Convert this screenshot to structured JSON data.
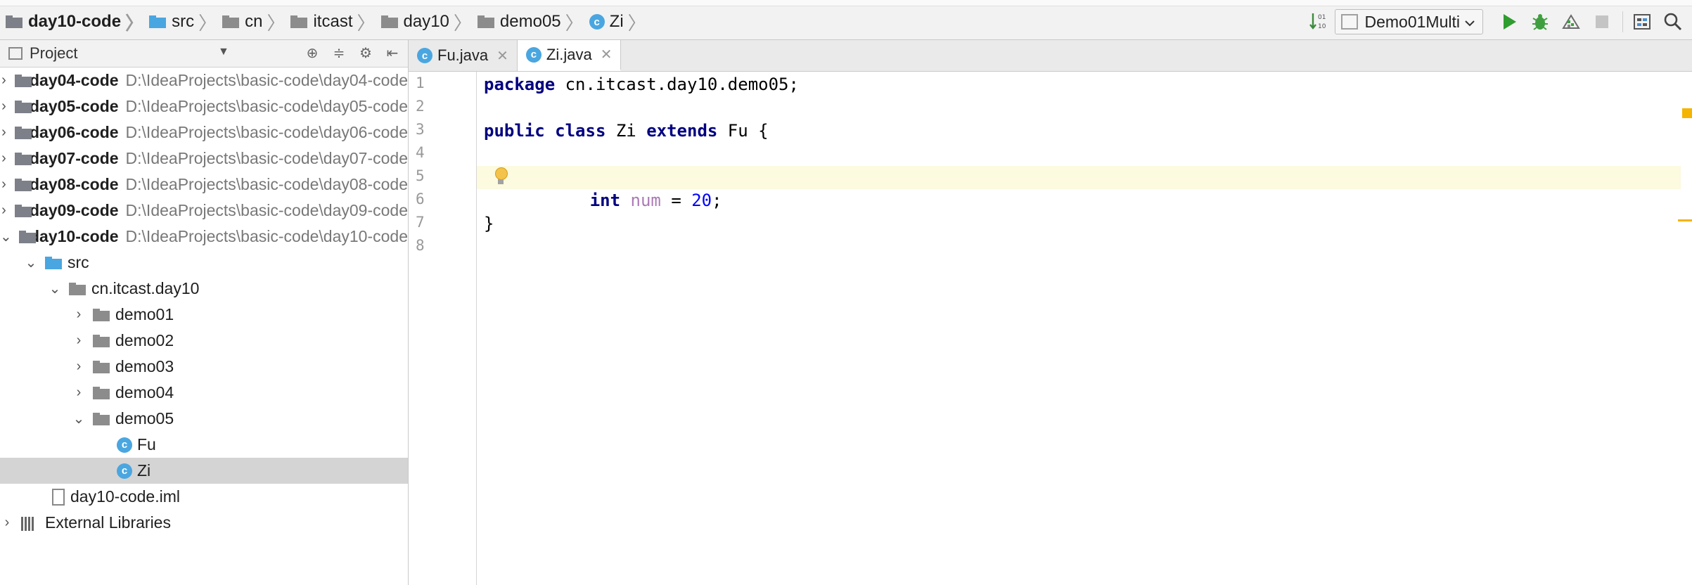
{
  "breadcrumb": {
    "items": [
      {
        "label": "day10-code",
        "icon": "module-folder-icon",
        "bold": true
      },
      {
        "label": "src",
        "icon": "source-folder-icon"
      },
      {
        "label": "cn",
        "icon": "package-folder-icon"
      },
      {
        "label": "itcast",
        "icon": "package-folder-icon"
      },
      {
        "label": "day10",
        "icon": "package-folder-icon"
      },
      {
        "label": "demo05",
        "icon": "package-folder-icon"
      },
      {
        "label": "Zi",
        "icon": "java-class-icon"
      }
    ]
  },
  "toolbar": {
    "run_config_label": "Demo01Multi",
    "icons": [
      "sort-icon",
      "run-icon",
      "debug-icon",
      "coverage-icon",
      "stop-icon",
      "project-structure-icon",
      "search-icon"
    ]
  },
  "project_pane": {
    "title": "Project",
    "tree": [
      {
        "name": "day04-code",
        "path": "D:\\IdeaProjects\\basic-code\\day04-code",
        "expanded": false
      },
      {
        "name": "day05-code",
        "path": "D:\\IdeaProjects\\basic-code\\day05-code",
        "expanded": false
      },
      {
        "name": "day06-code",
        "path": "D:\\IdeaProjects\\basic-code\\day06-code",
        "expanded": false
      },
      {
        "name": "day07-code",
        "path": "D:\\IdeaProjects\\basic-code\\day07-code",
        "expanded": false
      },
      {
        "name": "day08-code",
        "path": "D:\\IdeaProjects\\basic-code\\day08-code",
        "expanded": false
      },
      {
        "name": "day09-code",
        "path": "D:\\IdeaProjects\\basic-code\\day09-code",
        "expanded": false
      },
      {
        "name": "day10-code",
        "path": "D:\\IdeaProjects\\basic-code\\day10-code",
        "expanded": true
      }
    ],
    "src_label": "src",
    "package_label": "cn.itcast.day10",
    "packages": [
      "demo01",
      "demo02",
      "demo03",
      "demo04"
    ],
    "open_package": "demo05",
    "classes": [
      "Fu",
      "Zi"
    ],
    "selected_class": "Zi",
    "iml_file": "day10-code.iml",
    "external_libraries": "External Libraries"
  },
  "editor": {
    "tabs": [
      {
        "label": "Fu.java",
        "active": false
      },
      {
        "label": "Zi.java",
        "active": true
      }
    ],
    "line_numbers": [
      "1",
      "2",
      "3",
      "4",
      "5",
      "6",
      "7",
      "8"
    ],
    "code": {
      "l1_kw": "package",
      "l1_rest": " cn.itcast.day10.demo05;",
      "l3_kw1": "public",
      "l3_kw2": "class",
      "l3_name": " Zi ",
      "l3_kw3": "extends",
      "l3_rest": " Fu {",
      "l5_kw": "int",
      "l5_field": "num",
      "l5_eq": " = ",
      "l5_num": "20",
      "l5_end": ";",
      "l7": "}"
    }
  }
}
